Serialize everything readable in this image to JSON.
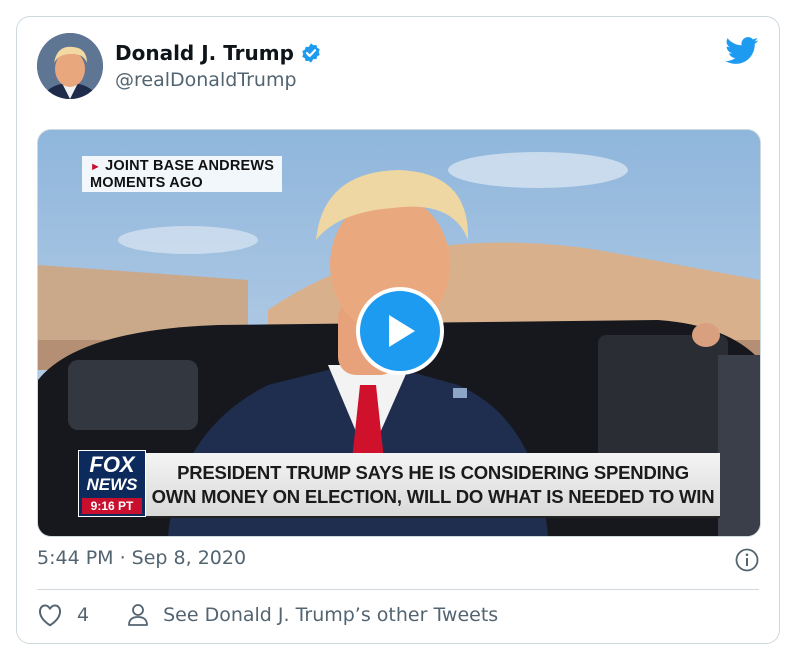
{
  "author": {
    "name": "Donald J. Trump",
    "handle": "@realDonaldTrump",
    "verified": true
  },
  "media": {
    "location_tag": [
      "JOINT BASE ANDREWS",
      "MOMENTS AGO"
    ],
    "lower_third": [
      "PRESIDENT TRUMP SAYS HE IS CONSIDERING SPENDING",
      "OWN MONEY ON ELECTION, WILL DO WHAT IS NEEDED TO WIN"
    ],
    "network_logo": [
      "FOX",
      "NEWS"
    ],
    "network_time": "9:16 PT"
  },
  "timestamp": "5:44 PM · Sep 8, 2020",
  "actions": {
    "like_count": "4",
    "profile_link": "See Donald J. Trump’s other Tweets"
  },
  "colors": {
    "twitter_blue": "#1d9bf0",
    "text_secondary": "#536471",
    "border": "#cfd9de"
  },
  "icons": [
    "twitter-bird-icon",
    "verified-badge-icon",
    "play-icon",
    "info-icon",
    "heart-icon",
    "person-icon"
  ]
}
